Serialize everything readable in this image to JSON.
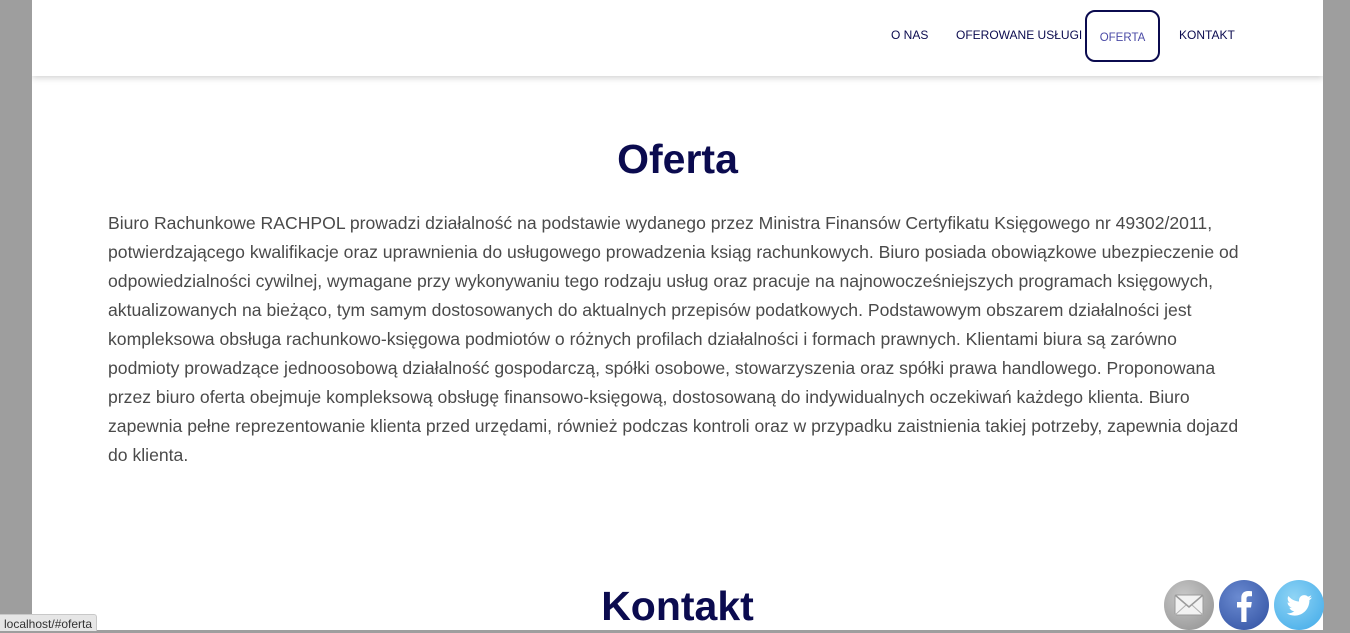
{
  "nav": {
    "items": [
      {
        "label": "O NAS"
      },
      {
        "label": "OFEROWANE USŁUGI"
      },
      {
        "label": "OFERTA",
        "active": true
      },
      {
        "label": "KONTAKT"
      }
    ],
    "active_border_color": "#0b0b4f"
  },
  "oferta": {
    "title": "Oferta",
    "text": "Biuro Rachunkowe RACHPOL prowadzi działalność na podstawie wydanego przez Ministra Finansów Certyfikatu Księgowego nr 49302/2011, potwierdzającego kwalifikacje oraz uprawnienia do usługowego prowadzenia ksiąg rachunkowych. Biuro posiada obowiązkowe ubezpieczenie od odpowiedzialności cywilnej, wymagane przy wykonywaniu tego rodzaju usług oraz pracuje na najnowocześniejszych programach księgowych, aktualizowanych na bieżąco, tym samym dostosowanych do aktualnych przepisów podatkowych. Podstawowym obszarem działalności jest kompleksowa obsługa rachunkowo-księgowa podmiotów o różnych profilach działalności i formach prawnych. Klientami biura są zarówno podmioty prowadzące jednoosobową działalność gospodarczą, spółki osobowe, stowarzyszenia oraz spółki prawa handlowego. Proponowana przez biuro oferta obejmuje kompleksową obsługę finansowo-księgową, dostosowaną do indywidualnych oczekiwań każdego klienta. Biuro zapewnia pełne reprezentowanie klienta przed urzędami, również podczas kontroli oraz w przypadku zaistnienia takiej potrzeby, zapewnia dojazd do klienta."
  },
  "kontakt": {
    "title": "Kontakt"
  },
  "status_bar": {
    "url": "localhost/#oferta"
  },
  "social": {
    "icons": [
      "email-icon",
      "facebook-icon",
      "twitter-icon"
    ]
  },
  "colors": {
    "heading": "#0b0b4f",
    "body_text": "#4a4a4a",
    "backdrop": "#9e9e9e"
  }
}
